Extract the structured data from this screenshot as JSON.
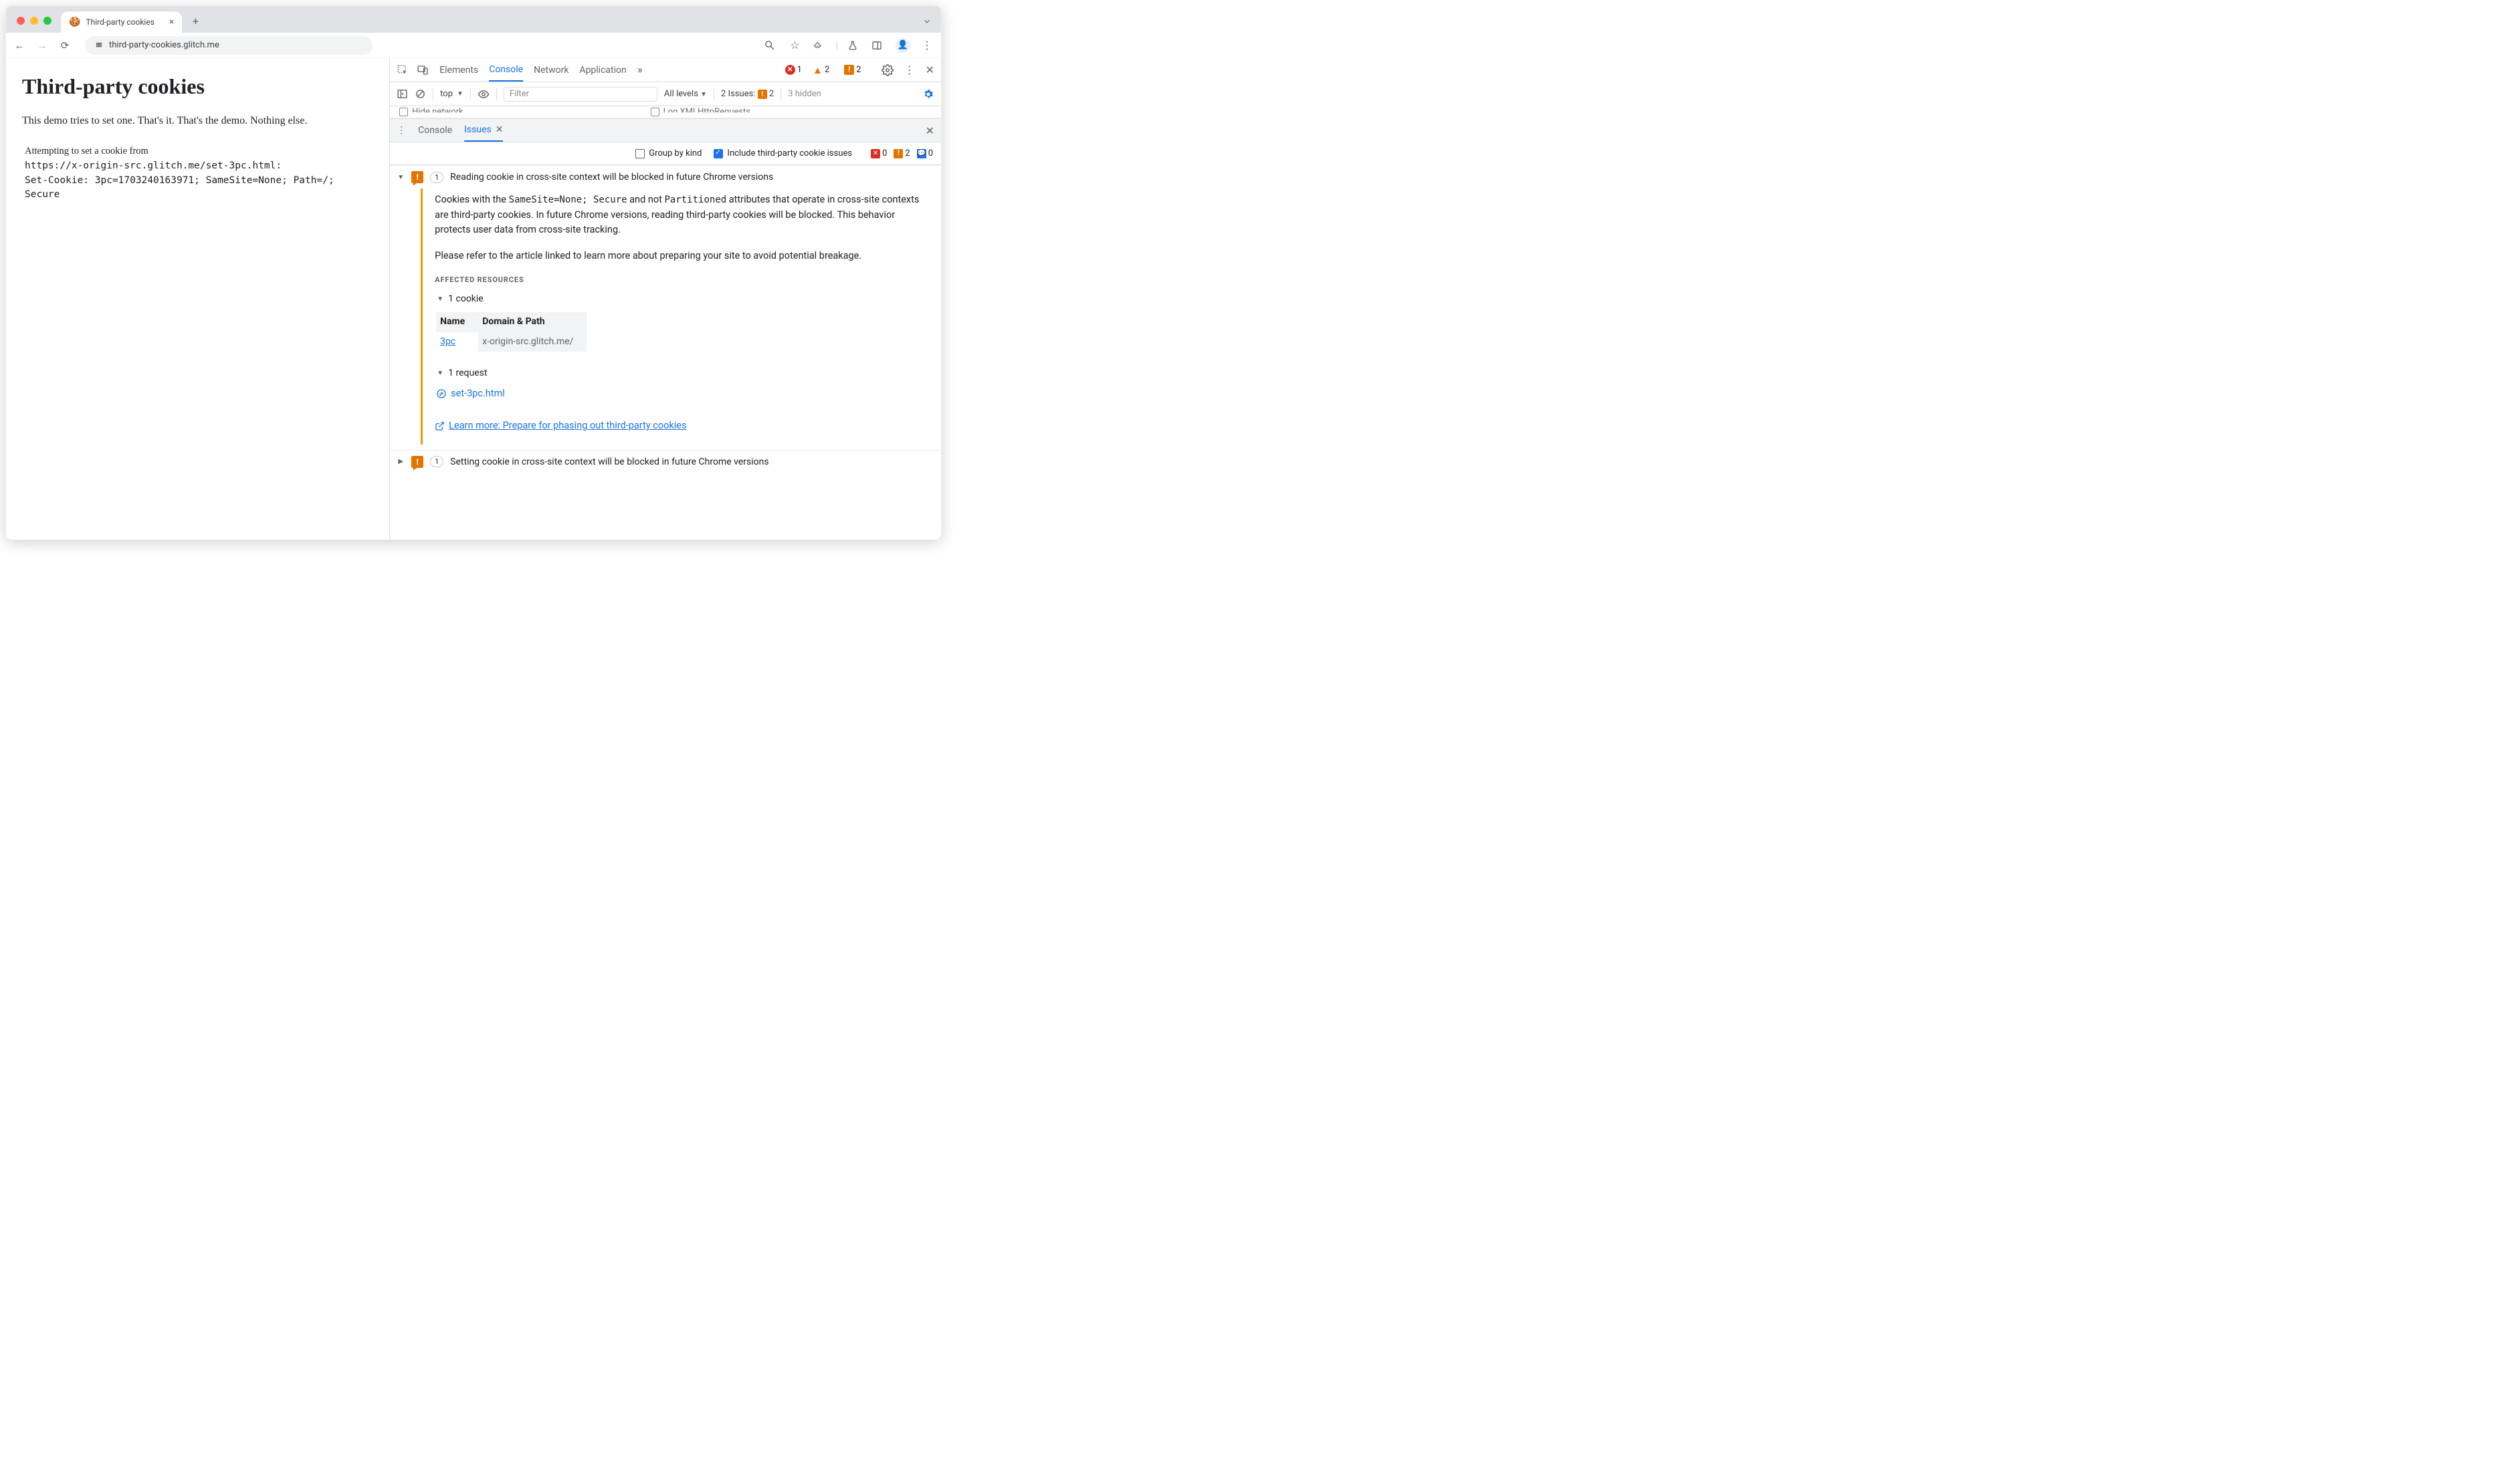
{
  "browser_tab": {
    "title": "Third-party cookies"
  },
  "addr": {
    "url": "third-party-cookies.glitch.me"
  },
  "page": {
    "h1": "Third-party cookies",
    "intro": "This demo tries to set one. That's it. That's the demo. Nothing else.",
    "attempt_prefix": "Attempting to set a cookie from",
    "attempt_url": "https://x-origin-src.glitch.me/set-3pc.html:",
    "set_cookie": "Set-Cookie: 3pc=1703240163971; SameSite=None; Path=/; Secure"
  },
  "dt_tabs": {
    "elements": "Elements",
    "console": "Console",
    "network": "Network",
    "application": "Application"
  },
  "dt_counts": {
    "errors": "1",
    "warns": "2",
    "issue_warns": "2"
  },
  "toolbar": {
    "context": "top",
    "filter_placeholder": "Filter",
    "levels": "All levels",
    "issues_label": "2 Issues:",
    "issues_count": "2",
    "hidden": "3 hidden"
  },
  "pref": {
    "hide": "Hide network",
    "xml": "Log XMLHttpRequests"
  },
  "drawer": {
    "console": "Console",
    "issues": "Issues"
  },
  "iss_opts": {
    "group": "Group by kind",
    "include": "Include third-party cookie issues",
    "err_n": "0",
    "warn_n": "2",
    "info_n": "0"
  },
  "issue1": {
    "count": "1",
    "title": "Reading cookie in cross-site context will be blocked in future Chrome versions",
    "p1a": "Cookies with the ",
    "p1b": "SameSite=None; Secure",
    "p1c": " and not ",
    "p1d": "Partitioned",
    "p1e": " attributes that operate in cross-site contexts are third-party cookies. In future Chrome versions, reading third-party cookies will be blocked. This behavior protects user data from cross-site tracking.",
    "p2": "Please refer to the article linked to learn more about preparing your site to avoid potential breakage.",
    "aff": "AFFECTED RESOURCES",
    "cookie_count": "1 cookie",
    "th_name": "Name",
    "th_dp": "Domain & Path",
    "td_name": "3pc",
    "td_dp": "x-origin-src.glitch.me/",
    "req_count": "1 request",
    "req_name": "set-3pc.html",
    "learn": "Learn more: Prepare for phasing out third-party cookies"
  },
  "issue2": {
    "count": "1",
    "title": "Setting cookie in cross-site context will be blocked in future Chrome versions"
  }
}
